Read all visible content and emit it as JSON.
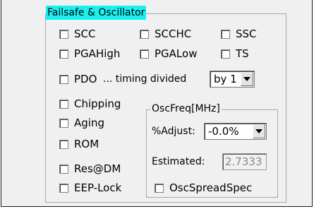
{
  "failsafe_group": {
    "title": "Failsafe & Oscillator",
    "title_highlight_color": "#19f0f0"
  },
  "checkboxes": {
    "scc": "SCC",
    "scchc": "SCCHC",
    "ssc": "SSC",
    "pgahigh": "PGAHigh",
    "pgalow": "PGALow",
    "ts": "TS",
    "pdo": "PDO",
    "chipping": "Chipping",
    "aging": "Aging",
    "rom": "ROM",
    "res_dm": "Res@DM",
    "eep_lock": "EEP-Lock",
    "osc_spread_spec": "OscSpreadSpec"
  },
  "timing": {
    "label": "... timing divided",
    "selected": "by 1"
  },
  "osc_group": {
    "title": "OscFreq[MHz]",
    "adjust_label": "%Adjust:",
    "adjust_selected": "-0.0%",
    "estimated_label": "Estimated:",
    "estimated_value": "2.7333"
  }
}
